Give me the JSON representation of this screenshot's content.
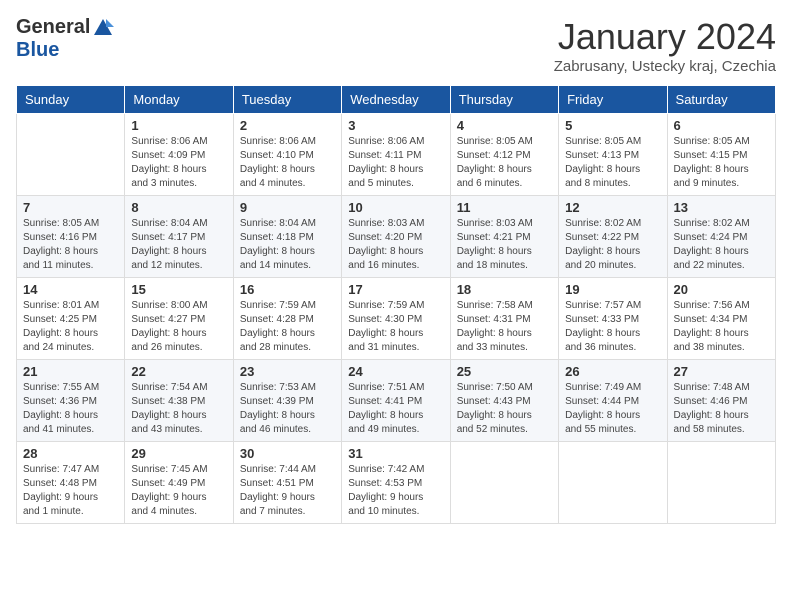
{
  "logo": {
    "general": "General",
    "blue": "Blue"
  },
  "header": {
    "title": "January 2024",
    "subtitle": "Zabrusany, Ustecky kraj, Czechia"
  },
  "weekdays": [
    "Sunday",
    "Monday",
    "Tuesday",
    "Wednesday",
    "Thursday",
    "Friday",
    "Saturday"
  ],
  "weeks": [
    [
      {
        "day": null,
        "info": null
      },
      {
        "day": "1",
        "info": "Sunrise: 8:06 AM\nSunset: 4:09 PM\nDaylight: 8 hours\nand 3 minutes."
      },
      {
        "day": "2",
        "info": "Sunrise: 8:06 AM\nSunset: 4:10 PM\nDaylight: 8 hours\nand 4 minutes."
      },
      {
        "day": "3",
        "info": "Sunrise: 8:06 AM\nSunset: 4:11 PM\nDaylight: 8 hours\nand 5 minutes."
      },
      {
        "day": "4",
        "info": "Sunrise: 8:05 AM\nSunset: 4:12 PM\nDaylight: 8 hours\nand 6 minutes."
      },
      {
        "day": "5",
        "info": "Sunrise: 8:05 AM\nSunset: 4:13 PM\nDaylight: 8 hours\nand 8 minutes."
      },
      {
        "day": "6",
        "info": "Sunrise: 8:05 AM\nSunset: 4:15 PM\nDaylight: 8 hours\nand 9 minutes."
      }
    ],
    [
      {
        "day": "7",
        "info": "Sunrise: 8:05 AM\nSunset: 4:16 PM\nDaylight: 8 hours\nand 11 minutes."
      },
      {
        "day": "8",
        "info": "Sunrise: 8:04 AM\nSunset: 4:17 PM\nDaylight: 8 hours\nand 12 minutes."
      },
      {
        "day": "9",
        "info": "Sunrise: 8:04 AM\nSunset: 4:18 PM\nDaylight: 8 hours\nand 14 minutes."
      },
      {
        "day": "10",
        "info": "Sunrise: 8:03 AM\nSunset: 4:20 PM\nDaylight: 8 hours\nand 16 minutes."
      },
      {
        "day": "11",
        "info": "Sunrise: 8:03 AM\nSunset: 4:21 PM\nDaylight: 8 hours\nand 18 minutes."
      },
      {
        "day": "12",
        "info": "Sunrise: 8:02 AM\nSunset: 4:22 PM\nDaylight: 8 hours\nand 20 minutes."
      },
      {
        "day": "13",
        "info": "Sunrise: 8:02 AM\nSunset: 4:24 PM\nDaylight: 8 hours\nand 22 minutes."
      }
    ],
    [
      {
        "day": "14",
        "info": "Sunrise: 8:01 AM\nSunset: 4:25 PM\nDaylight: 8 hours\nand 24 minutes."
      },
      {
        "day": "15",
        "info": "Sunrise: 8:00 AM\nSunset: 4:27 PM\nDaylight: 8 hours\nand 26 minutes."
      },
      {
        "day": "16",
        "info": "Sunrise: 7:59 AM\nSunset: 4:28 PM\nDaylight: 8 hours\nand 28 minutes."
      },
      {
        "day": "17",
        "info": "Sunrise: 7:59 AM\nSunset: 4:30 PM\nDaylight: 8 hours\nand 31 minutes."
      },
      {
        "day": "18",
        "info": "Sunrise: 7:58 AM\nSunset: 4:31 PM\nDaylight: 8 hours\nand 33 minutes."
      },
      {
        "day": "19",
        "info": "Sunrise: 7:57 AM\nSunset: 4:33 PM\nDaylight: 8 hours\nand 36 minutes."
      },
      {
        "day": "20",
        "info": "Sunrise: 7:56 AM\nSunset: 4:34 PM\nDaylight: 8 hours\nand 38 minutes."
      }
    ],
    [
      {
        "day": "21",
        "info": "Sunrise: 7:55 AM\nSunset: 4:36 PM\nDaylight: 8 hours\nand 41 minutes."
      },
      {
        "day": "22",
        "info": "Sunrise: 7:54 AM\nSunset: 4:38 PM\nDaylight: 8 hours\nand 43 minutes."
      },
      {
        "day": "23",
        "info": "Sunrise: 7:53 AM\nSunset: 4:39 PM\nDaylight: 8 hours\nand 46 minutes."
      },
      {
        "day": "24",
        "info": "Sunrise: 7:51 AM\nSunset: 4:41 PM\nDaylight: 8 hours\nand 49 minutes."
      },
      {
        "day": "25",
        "info": "Sunrise: 7:50 AM\nSunset: 4:43 PM\nDaylight: 8 hours\nand 52 minutes."
      },
      {
        "day": "26",
        "info": "Sunrise: 7:49 AM\nSunset: 4:44 PM\nDaylight: 8 hours\nand 55 minutes."
      },
      {
        "day": "27",
        "info": "Sunrise: 7:48 AM\nSunset: 4:46 PM\nDaylight: 8 hours\nand 58 minutes."
      }
    ],
    [
      {
        "day": "28",
        "info": "Sunrise: 7:47 AM\nSunset: 4:48 PM\nDaylight: 9 hours\nand 1 minute."
      },
      {
        "day": "29",
        "info": "Sunrise: 7:45 AM\nSunset: 4:49 PM\nDaylight: 9 hours\nand 4 minutes."
      },
      {
        "day": "30",
        "info": "Sunrise: 7:44 AM\nSunset: 4:51 PM\nDaylight: 9 hours\nand 7 minutes."
      },
      {
        "day": "31",
        "info": "Sunrise: 7:42 AM\nSunset: 4:53 PM\nDaylight: 9 hours\nand 10 minutes."
      },
      {
        "day": null,
        "info": null
      },
      {
        "day": null,
        "info": null
      },
      {
        "day": null,
        "info": null
      }
    ]
  ]
}
